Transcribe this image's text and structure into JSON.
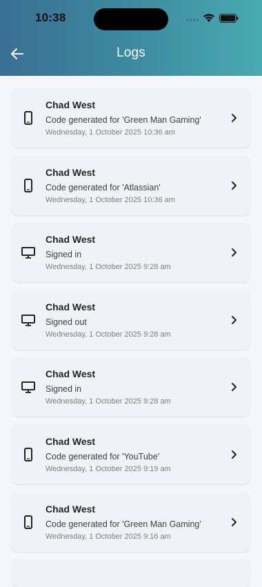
{
  "status_bar": {
    "time": "10:38"
  },
  "header": {
    "title": "Logs"
  },
  "logs": [
    {
      "name": "Chad West",
      "action": "Code generated for 'Green Man Gaming'",
      "time": "Wednesday, 1 October 2025 10:36 am",
      "icon": "phone-icon"
    },
    {
      "name": "Chad West",
      "action": "Code generated for 'Atlassian'",
      "time": "Wednesday, 1 October 2025 10:36 am",
      "icon": "phone-icon"
    },
    {
      "name": "Chad West",
      "action": "Signed in",
      "time": "Wednesday, 1 October 2025 9:28 am",
      "icon": "desktop-icon"
    },
    {
      "name": "Chad West",
      "action": "Signed out",
      "time": "Wednesday, 1 October 2025 9:28 am",
      "icon": "desktop-icon"
    },
    {
      "name": "Chad West",
      "action": "Signed in",
      "time": "Wednesday, 1 October 2025 9:28 am",
      "icon": "desktop-icon"
    },
    {
      "name": "Chad West",
      "action": "Code generated for 'YouTube'",
      "time": "Wednesday, 1 October 2025 9:19 am",
      "icon": "phone-icon"
    },
    {
      "name": "Chad West",
      "action": "Code generated for 'Green Man Gaming'",
      "time": "Wednesday, 1 October 2025 9:16 am",
      "icon": "phone-icon"
    }
  ],
  "colors": {
    "header_gradient_start": "#3a6f94",
    "header_gradient_end": "#49aab0",
    "background": "#f5f7fc",
    "card": "#f0f2f7"
  }
}
